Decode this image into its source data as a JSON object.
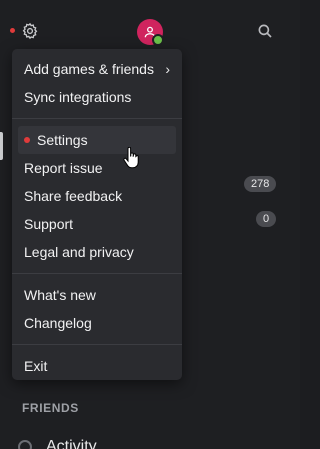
{
  "topbar": {
    "settings_icon": "gear-icon",
    "avatar_icon": "user-icon",
    "search_icon": "search-icon",
    "notification_color": "#e03b3b",
    "avatar_color": "#d0245e",
    "online_color": "#6cc04a"
  },
  "menu": {
    "group1": [
      {
        "label": "Add games & friends",
        "has_submenu": true
      },
      {
        "label": "Sync integrations"
      }
    ],
    "group2": [
      {
        "label": "Settings",
        "has_dot": true
      },
      {
        "label": "Report issue"
      },
      {
        "label": "Share feedback"
      },
      {
        "label": "Support"
      },
      {
        "label": "Legal and privacy"
      }
    ],
    "group3": [
      {
        "label": "What's new"
      },
      {
        "label": "Changelog"
      }
    ],
    "group4": [
      {
        "label": "Exit"
      }
    ],
    "submenu_glyph": "›"
  },
  "background": {
    "badges": [
      "278",
      "0"
    ],
    "section_title": "FRIENDS",
    "activity_label": "Activity"
  }
}
